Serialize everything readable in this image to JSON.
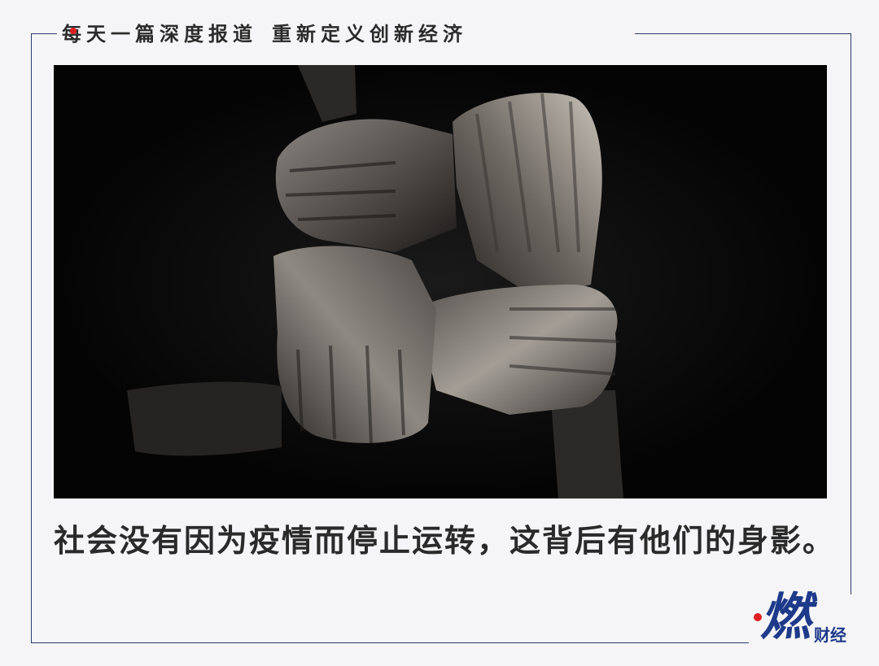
{
  "header": {
    "tagline_part1": "每天一篇深度报道",
    "tagline_part2": "重新定义创新经济"
  },
  "photo": {
    "description_icon": "four-hands-clasped-wrists-image"
  },
  "caption": {
    "text": "社会没有因为疫情而停止运转，这背后有他们的身影。"
  },
  "logo": {
    "main": "燃",
    "sub": "财经"
  },
  "colors": {
    "background": "#f5f5f7",
    "frame": "#2a3a6a",
    "brand_blue": "#1e3a8a",
    "accent_red": "#e02020",
    "text_dark": "#2a2a2a"
  }
}
